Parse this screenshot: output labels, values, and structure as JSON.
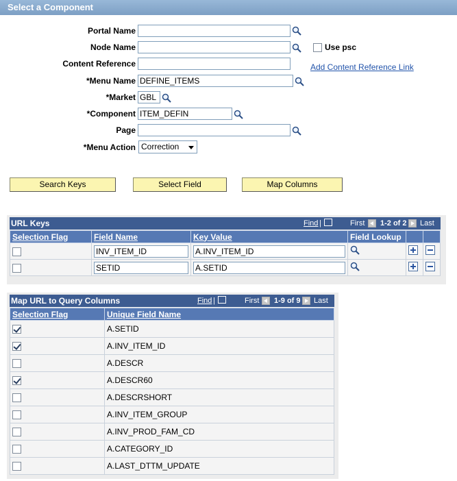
{
  "header": {
    "title": "Select a Component"
  },
  "form": {
    "portal_name_label": "Portal Name",
    "portal_name_value": "",
    "node_name_label": "Node Name",
    "node_name_value": "",
    "use_psc_label": "Use psc",
    "content_reference_label": "Content Reference",
    "content_reference_value": "",
    "add_link_label": "Add Content Reference Link",
    "menu_name_label": "*Menu Name",
    "menu_name_value": "DEFINE_ITEMS",
    "market_label": "*Market",
    "market_value": "GBL",
    "component_label": "*Component",
    "component_value": "ITEM_DEFIN",
    "page_label": "Page",
    "page_value": "",
    "menu_action_label": "*Menu Action",
    "menu_action_value": "Correction"
  },
  "buttons": {
    "search_keys": "Search Keys",
    "select_field": "Select Field",
    "map_columns": "Map Columns"
  },
  "url_keys": {
    "title": "URL Keys",
    "find": "Find",
    "first": "First",
    "range": "1-2 of 2",
    "last": "Last",
    "columns": [
      "Selection Flag",
      "Field Name",
      "Key Value",
      "Field Lookup"
    ],
    "rows": [
      {
        "field_name": "INV_ITEM_ID",
        "key_value": "A.INV_ITEM_ID"
      },
      {
        "field_name": "SETID",
        "key_value": "A.SETID"
      }
    ]
  },
  "map_url": {
    "title": "Map URL to Query Columns",
    "find": "Find",
    "first": "First",
    "range": "1-9 of 9",
    "last": "Last",
    "columns": [
      "Selection Flag",
      "Unique Field Name"
    ],
    "rows": [
      {
        "checked": true,
        "name": "A.SETID"
      },
      {
        "checked": true,
        "name": "A.INV_ITEM_ID"
      },
      {
        "checked": false,
        "name": "A.DESCR"
      },
      {
        "checked": true,
        "name": "A.DESCR60"
      },
      {
        "checked": false,
        "name": "A.DESCRSHORT"
      },
      {
        "checked": false,
        "name": "A.INV_ITEM_GROUP"
      },
      {
        "checked": false,
        "name": "A.INV_PROD_FAM_CD"
      },
      {
        "checked": false,
        "name": "A.CATEGORY_ID"
      },
      {
        "checked": false,
        "name": "A.LAST_DTTM_UPDATE"
      }
    ]
  }
}
